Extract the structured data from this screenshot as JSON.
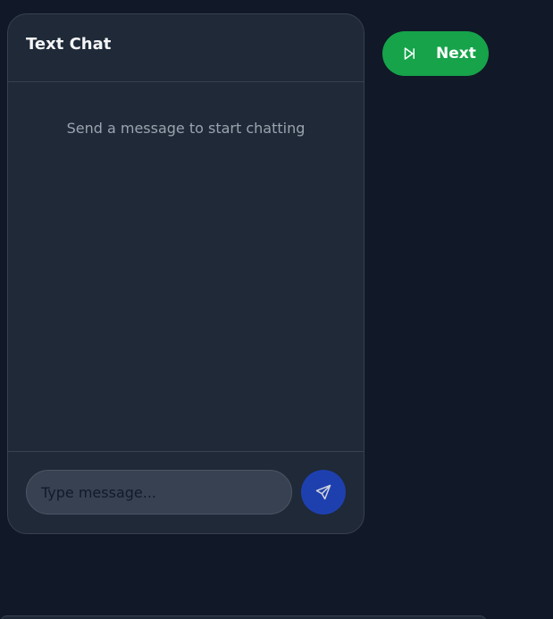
{
  "chat": {
    "title": "Text Chat",
    "empty_message": "Send a message to start chatting",
    "input_placeholder": "Type message...",
    "input_value": ""
  },
  "actions": {
    "next_label": "Next"
  },
  "icons": {
    "send": "send-icon",
    "next": "skip-forward-icon"
  },
  "colors": {
    "page_background": "#111827",
    "panel_background": "#1f2937",
    "send_button": "#1e40af",
    "next_button": "#16a34a"
  }
}
